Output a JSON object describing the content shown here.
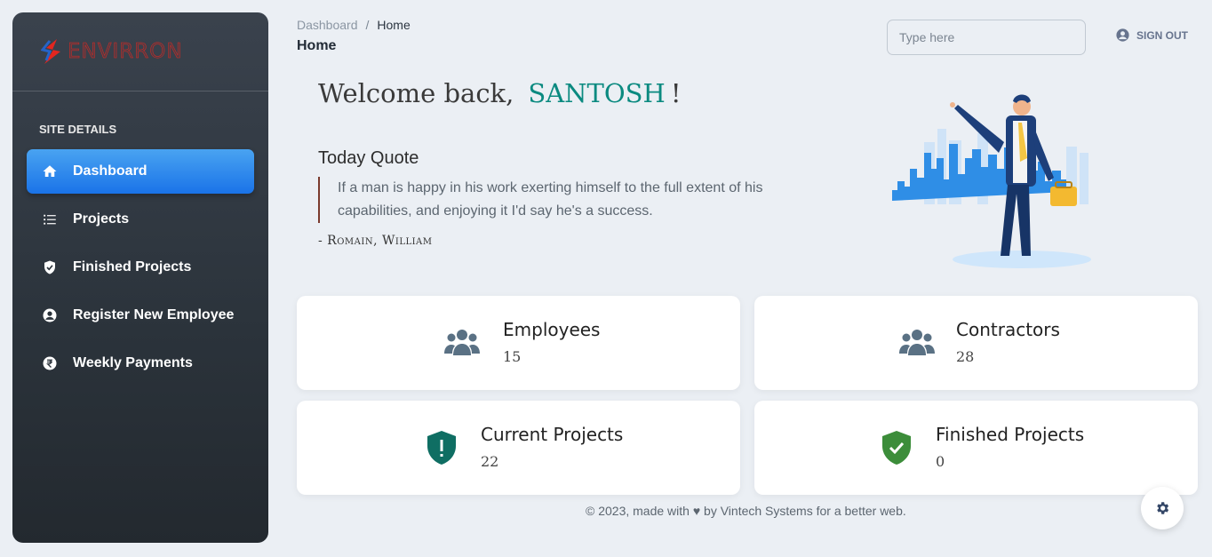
{
  "brand": {
    "name": "ENVIRRON"
  },
  "sidebar": {
    "section_title": "SITE DETAILS",
    "items": [
      {
        "label": "Dashboard",
        "icon": "home-icon",
        "active": true
      },
      {
        "label": "Projects",
        "icon": "list-icon"
      },
      {
        "label": "Finished Projects",
        "icon": "shield-check-icon"
      },
      {
        "label": "Register New Employee",
        "icon": "user-circle-icon"
      },
      {
        "label": "Weekly Payments",
        "icon": "rupee-icon"
      }
    ]
  },
  "header": {
    "breadcrumb": {
      "parent": "Dashboard",
      "separator": "/",
      "current": "Home"
    },
    "title": "Home",
    "search": {
      "placeholder": "Type here",
      "value": ""
    },
    "sign_out": "SIGN OUT"
  },
  "welcome": {
    "greeting": "Welcome back,",
    "name": "SANTOSH",
    "suffix": "!"
  },
  "quote": {
    "heading": "Today Quote",
    "text": "If a man is happy in his work exerting himself to the full extent of his capabilities, and enjoying it I'd say he's a success.",
    "author": "- Romain, William"
  },
  "stats": [
    {
      "label": "Employees",
      "value": "15",
      "icon": "users-icon"
    },
    {
      "label": "Contractors",
      "value": "28",
      "icon": "users-icon"
    },
    {
      "label": "Current Projects",
      "value": "22",
      "icon": "shield-alert-icon"
    },
    {
      "label": "Finished Projects",
      "value": "0",
      "icon": "shield-check-icon"
    }
  ],
  "footer": {
    "prefix": "© 2023, made with",
    "suffix": "by Vintech Systems for a better web."
  },
  "colors": {
    "active_nav": "#1a73e8",
    "welcome_name": "#0b8a80",
    "brand": "#e3261f",
    "current_projects_icon": "#0f6e63",
    "finished_projects_icon": "#3c8d3a"
  }
}
